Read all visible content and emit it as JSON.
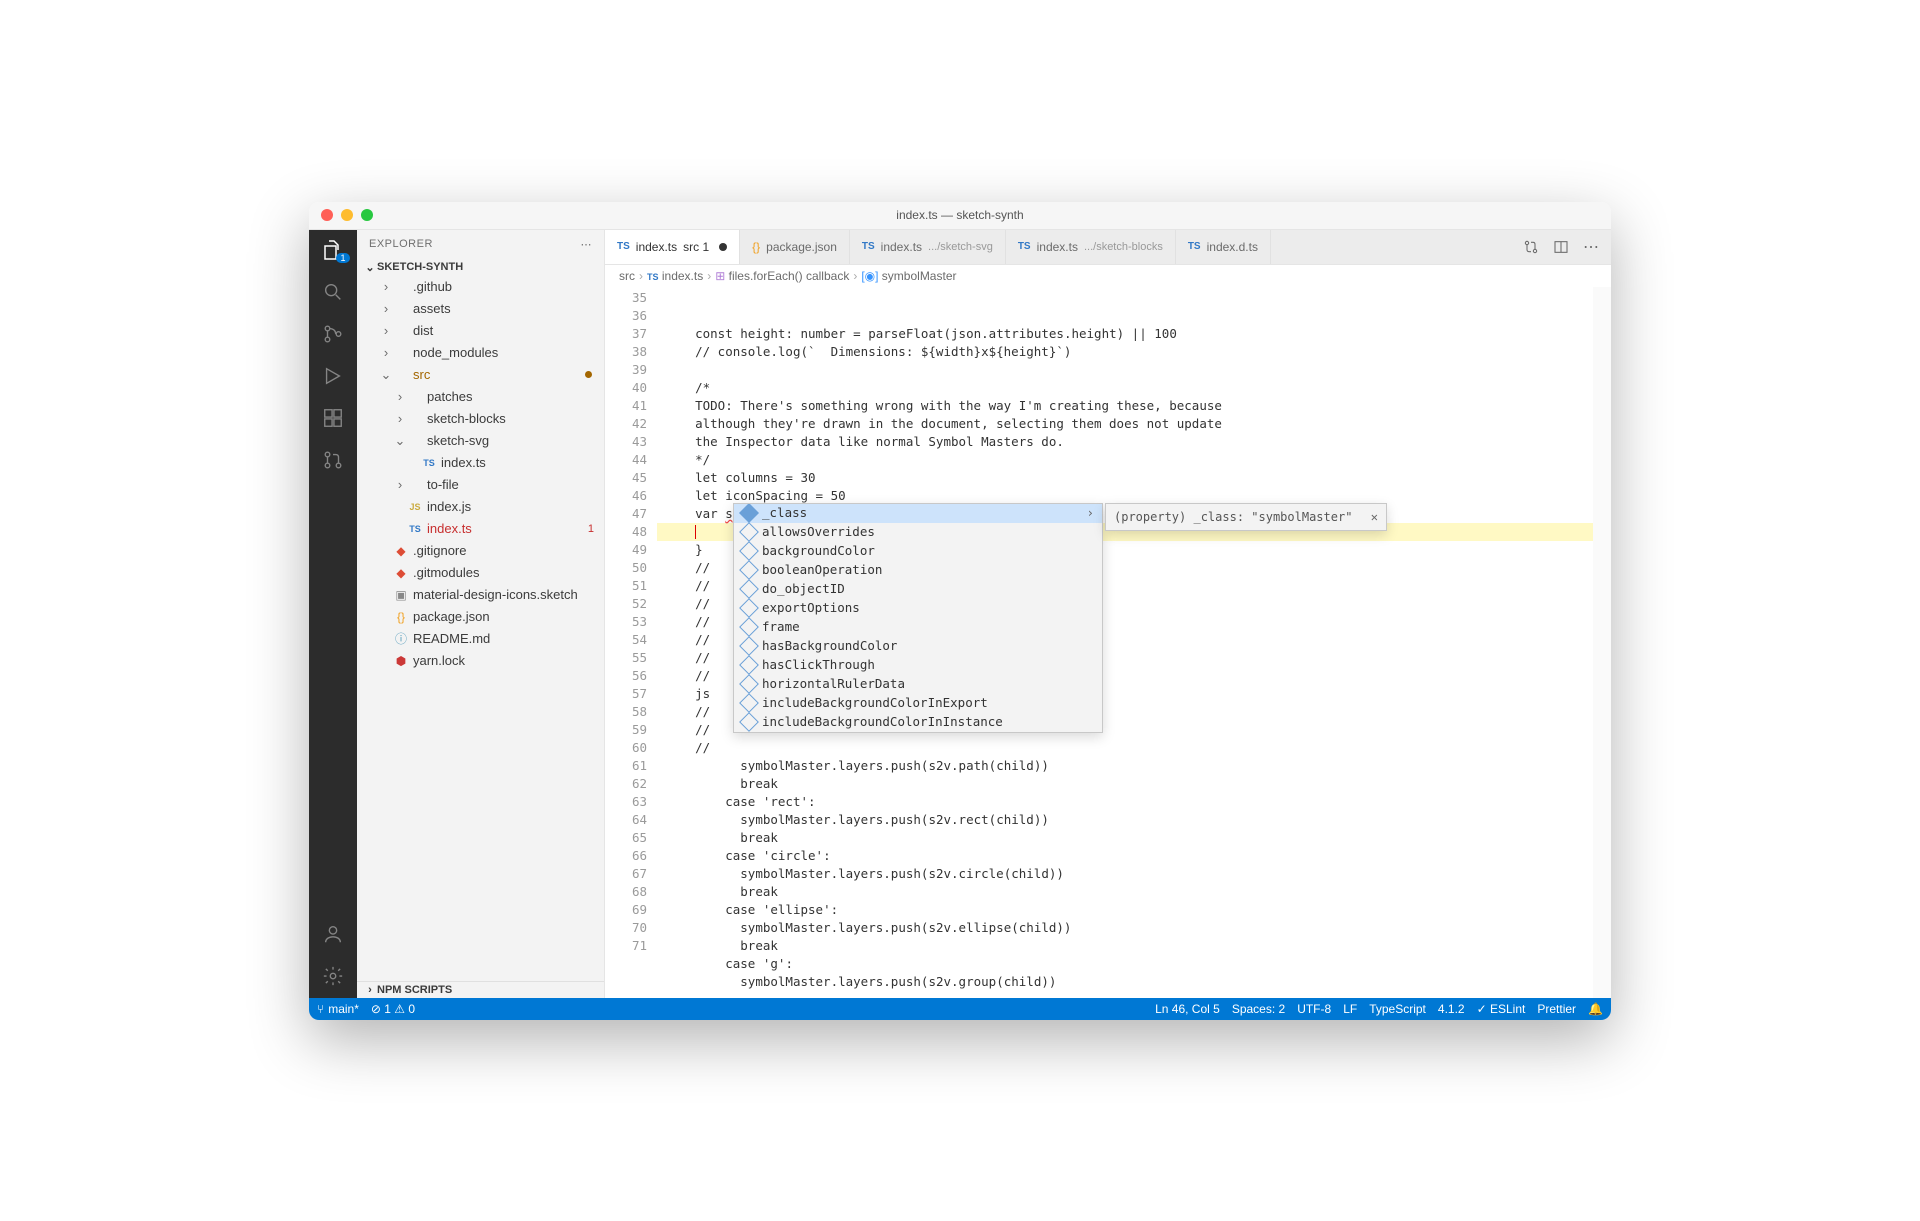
{
  "window": {
    "title": "index.ts — sketch-synth"
  },
  "sidebar": {
    "title": "EXPLORER",
    "project": "SKETCH-SYNTH",
    "npm": "NPM SCRIPTS",
    "tree": [
      {
        "indent": 1,
        "tw": "›",
        "label": ".github",
        "type": "folder"
      },
      {
        "indent": 1,
        "tw": "›",
        "label": "assets",
        "type": "folder"
      },
      {
        "indent": 1,
        "tw": "›",
        "label": "dist",
        "type": "folder"
      },
      {
        "indent": 1,
        "tw": "›",
        "label": "node_modules",
        "type": "folder"
      },
      {
        "indent": 1,
        "tw": "⌄",
        "label": "src",
        "type": "folder",
        "mod": true,
        "moddot": true
      },
      {
        "indent": 2,
        "tw": "›",
        "label": "patches",
        "type": "folder"
      },
      {
        "indent": 2,
        "tw": "›",
        "label": "sketch-blocks",
        "type": "folder"
      },
      {
        "indent": 2,
        "tw": "⌄",
        "label": "sketch-svg",
        "type": "folder"
      },
      {
        "indent": 3,
        "tw": "",
        "label": "index.ts",
        "type": "ts"
      },
      {
        "indent": 2,
        "tw": "›",
        "label": "to-file",
        "type": "folder"
      },
      {
        "indent": 2,
        "tw": "",
        "label": "index.js",
        "type": "js"
      },
      {
        "indent": 2,
        "tw": "",
        "label": "index.ts",
        "type": "ts",
        "err": true,
        "tail": "1"
      },
      {
        "indent": 1,
        "tw": "",
        "label": ".gitignore",
        "type": "git"
      },
      {
        "indent": 1,
        "tw": "",
        "label": ".gitmodules",
        "type": "git"
      },
      {
        "indent": 1,
        "tw": "",
        "label": "material-design-icons.sketch",
        "type": "sketch"
      },
      {
        "indent": 1,
        "tw": "",
        "label": "package.json",
        "type": "json"
      },
      {
        "indent": 1,
        "tw": "",
        "label": "README.md",
        "type": "md"
      },
      {
        "indent": 1,
        "tw": "",
        "label": "yarn.lock",
        "type": "lock"
      }
    ]
  },
  "tabs": [
    {
      "icon": "ts",
      "label": "index.ts",
      "suffix": "src 1",
      "active": true,
      "modified": true
    },
    {
      "icon": "json",
      "label": "package.json"
    },
    {
      "icon": "ts",
      "label": "index.ts",
      "dim": ".../sketch-svg"
    },
    {
      "icon": "ts",
      "label": "index.ts",
      "dim": ".../sketch-blocks"
    },
    {
      "icon": "ts",
      "label": "index.d.ts"
    }
  ],
  "breadcrumb": [
    "src",
    "index.ts",
    "files.forEach() callback",
    "symbolMaster"
  ],
  "code": {
    "start": 35,
    "lines": [
      "    <kw>const</kw> <prop>height</prop>: <typ>number</typ> = <fn>parseFloat</fn>(<prop>json</prop>.<prop>attributes</prop>.<prop>height</prop>) || <num>100</num>",
      "    <cmt>// console.log(`  Dimensions: ${width}x${height}`)</cmt>",
      "",
      "    <cmt>/*</cmt>",
      "    <cmt>TODO: There's something wrong with the way I'm creating these, because</cmt>",
      "    <cmt>although they're drawn in the document, selecting them does not update</cmt>",
      "    <cmt>the Inspector data like normal Symbol Masters do.</cmt>",
      "    <cmt>*/</cmt>",
      "    <kw>let</kw> <prop>columns</prop> = <num>30</num>",
      "    <kw>let</kw> <prop>iconSpacing</prop> = <num>50</num>",
      "    <kw>var</kw> <prop class='err-ul'>symbolMaster</prop>: <typ>FileFormat</typ>.<typ>SymbolMaster</typ> = <sym>{</sym>",
      "    <span class='cursor'></span>",
      "    <sym>}</sym>",
      "    <cmt>//</cmt>",
      "    <cmt>//</cmt>",
      "    <cmt>//</cmt>",
      "    <cmt>//</cmt>",
      "    <cmt>//</cmt>",
      "    <cmt>//</cmt>",
      "    <cmt>//</cmt>",
      "    <prop>js</prop>",
      "    <cmt>//</cmt>",
      "    <cmt>//</cmt>",
      "    <cmt>//</cmt>",
      "          <prop>symbolMaster</prop>.<prop>layers</prop>.<fn>push</fn>(<prop>s2v</prop>.<fn>path</fn>(<prop>child</prop>))",
      "          <ctl>break</ctl>",
      "        <ctl>case</ctl> <str>'rect'</str>:",
      "          <prop>symbolMaster</prop>.<prop>layers</prop>.<fn>push</fn>(<prop>s2v</prop>.<fn>rect</fn>(<prop>child</prop>))",
      "          <ctl>break</ctl>",
      "        <ctl>case</ctl> <str>'circle'</str>:",
      "          <prop>symbolMaster</prop>.<prop>layers</prop>.<fn>push</fn>(<prop>s2v</prop>.<fn>circle</fn>(<prop>child</prop>))",
      "          <ctl>break</ctl>",
      "        <ctl>case</ctl> <str>'ellipse'</str>:",
      "          <prop>symbolMaster</prop>.<prop>layers</prop>.<fn>push</fn>(<prop>s2v</prop>.<fn>ellipse</fn>(<prop>child</prop>))",
      "          <ctl>break</ctl>",
      "        <ctl>case</ctl> <str>'g'</str>:",
      "          <prop>symbolMaster</prop>.<prop>layers</prop>.<fn>push</fn>(<prop>s2v</prop>.<fn>group</fn>(<prop>child</prop>))"
    ],
    "highlight": 46,
    "modStart": 45,
    "modEnd": 54
  },
  "suggest": {
    "items": [
      "_class",
      "allowsOverrides",
      "backgroundColor",
      "booleanOperation",
      "do_objectID",
      "exportOptions",
      "frame",
      "hasBackgroundColor",
      "hasClickThrough",
      "horizontalRulerData",
      "includeBackgroundColorInExport",
      "includeBackgroundColorInInstance"
    ],
    "selected": 0,
    "detail": "(property) _class: \"symbolMaster\""
  },
  "status": {
    "branch": "main*",
    "problems": "⊘ 1 ⚠ 0",
    "pos": "Ln 46, Col 5",
    "spaces": "Spaces: 2",
    "enc": "UTF-8",
    "eol": "LF",
    "lang": "TypeScript",
    "ver": "4.1.2",
    "eslint": "✓ ESLint",
    "prettier": "Prettier"
  }
}
